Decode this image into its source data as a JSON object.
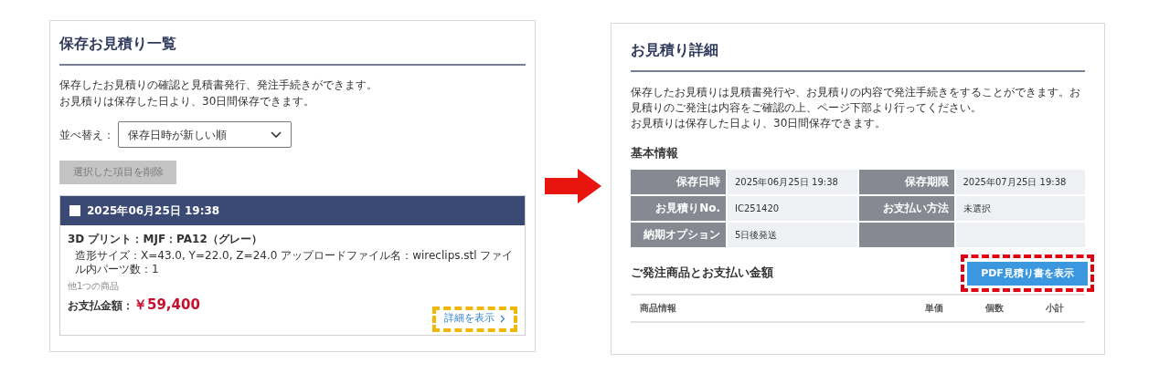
{
  "list_page": {
    "title": "保存お見積り一覧",
    "intro": [
      "保存したお見積りの確認と見積書発行、発注手続きができます。",
      "お見積りは保存した日より、30日間保存できます。"
    ],
    "sort": {
      "label": "並べ替え：",
      "value": "保存日時が新しい順"
    },
    "delete_button": {
      "label": "選択した項目を削除",
      "disabled": true
    },
    "quote": {
      "checked": false,
      "date": "2025年06月25日 19:38",
      "item_title": "3D プリント：MJF：PA12（グレー）",
      "item_detail": "造形サイズ：X=43.0, Y=22.0, Z=24.0 アップロードファイル名：wireclips.stl ファイル内パーツ数：1",
      "other_items": "他1つの商品",
      "total_label": "お支払金額：",
      "total": "￥59,400",
      "detail_link": {
        "label": "詳細を表示",
        "highlighted": true
      }
    }
  },
  "detail_page": {
    "title": "お見積り詳細",
    "intro": [
      "保存したお見積りは見積書発行や、お見積りの内容で発注手続きをすることができます。お見積りのご発注は内容をご確認の上、ページ下部より行ってください。",
      "お見積りは保存した日より、30日間保存できます。"
    ],
    "info_heading": "基本情報",
    "info_rows": [
      [
        {
          "label": "保存日時",
          "value": "2025年06月25日 19:38"
        },
        {
          "label": "保存期限",
          "value": "2025年07月25日 19:38"
        }
      ],
      [
        {
          "label": "お見積りNo.",
          "value": "IC251420"
        },
        {
          "label": "お支払い方法",
          "value": "未選択"
        }
      ],
      [
        {
          "label": "納期オプション",
          "value": "5日後発送"
        },
        {}
      ]
    ],
    "order_heading": "ご発注商品とお支払い金額",
    "pdf_button": {
      "label": "PDF見積り書を表示",
      "highlighted": true
    },
    "table": {
      "columns": [
        "商品情報",
        "単価",
        "個数",
        "小計"
      ]
    }
  }
}
